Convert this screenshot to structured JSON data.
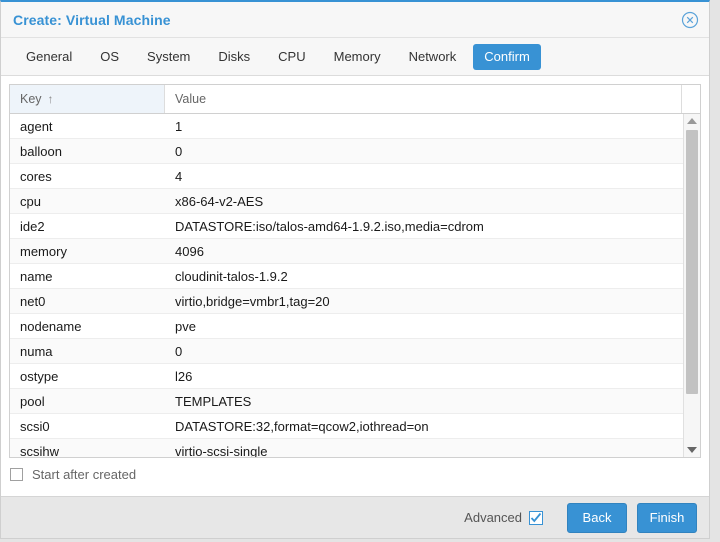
{
  "window": {
    "title": "Create: Virtual Machine",
    "close_icon": "close-circle-icon"
  },
  "tabs": [
    {
      "label": "General",
      "active": false
    },
    {
      "label": "OS",
      "active": false
    },
    {
      "label": "System",
      "active": false
    },
    {
      "label": "Disks",
      "active": false
    },
    {
      "label": "CPU",
      "active": false
    },
    {
      "label": "Memory",
      "active": false
    },
    {
      "label": "Network",
      "active": false
    },
    {
      "label": "Confirm",
      "active": true
    }
  ],
  "grid": {
    "columns": [
      {
        "label": "Key",
        "sorted": true,
        "sort_arrow": "↑"
      },
      {
        "label": "Value",
        "sorted": false,
        "sort_arrow": ""
      }
    ],
    "rows": [
      {
        "key": "agent",
        "value": "1"
      },
      {
        "key": "balloon",
        "value": "0"
      },
      {
        "key": "cores",
        "value": "4"
      },
      {
        "key": "cpu",
        "value": "x86-64-v2-AES"
      },
      {
        "key": "ide2",
        "value": "DATASTORE:iso/talos-amd64-1.9.2.iso,media=cdrom"
      },
      {
        "key": "memory",
        "value": "4096"
      },
      {
        "key": "name",
        "value": "cloudinit-talos-1.9.2"
      },
      {
        "key": "net0",
        "value": "virtio,bridge=vmbr1,tag=20"
      },
      {
        "key": "nodename",
        "value": "pve"
      },
      {
        "key": "numa",
        "value": "0"
      },
      {
        "key": "ostype",
        "value": "l26"
      },
      {
        "key": "pool",
        "value": "TEMPLATES"
      },
      {
        "key": "scsi0",
        "value": "DATASTORE:32,format=qcow2,iothread=on"
      },
      {
        "key": "scsihw",
        "value": "virtio-scsi-single"
      }
    ],
    "scrollbar": {
      "up_icon": "caret-up-icon",
      "down_icon": "caret-down-icon"
    }
  },
  "options": {
    "start_after_created_label": "Start after created",
    "start_after_created_checked": false
  },
  "footer": {
    "advanced_label": "Advanced",
    "advanced_checked": true,
    "back_label": "Back",
    "finish_label": "Finish"
  },
  "colors": {
    "accent": "#3892d4",
    "title_text": "#3892d4",
    "sorted_column_bg": "#eef4fa",
    "footer_bg": "#e7e7e7"
  }
}
